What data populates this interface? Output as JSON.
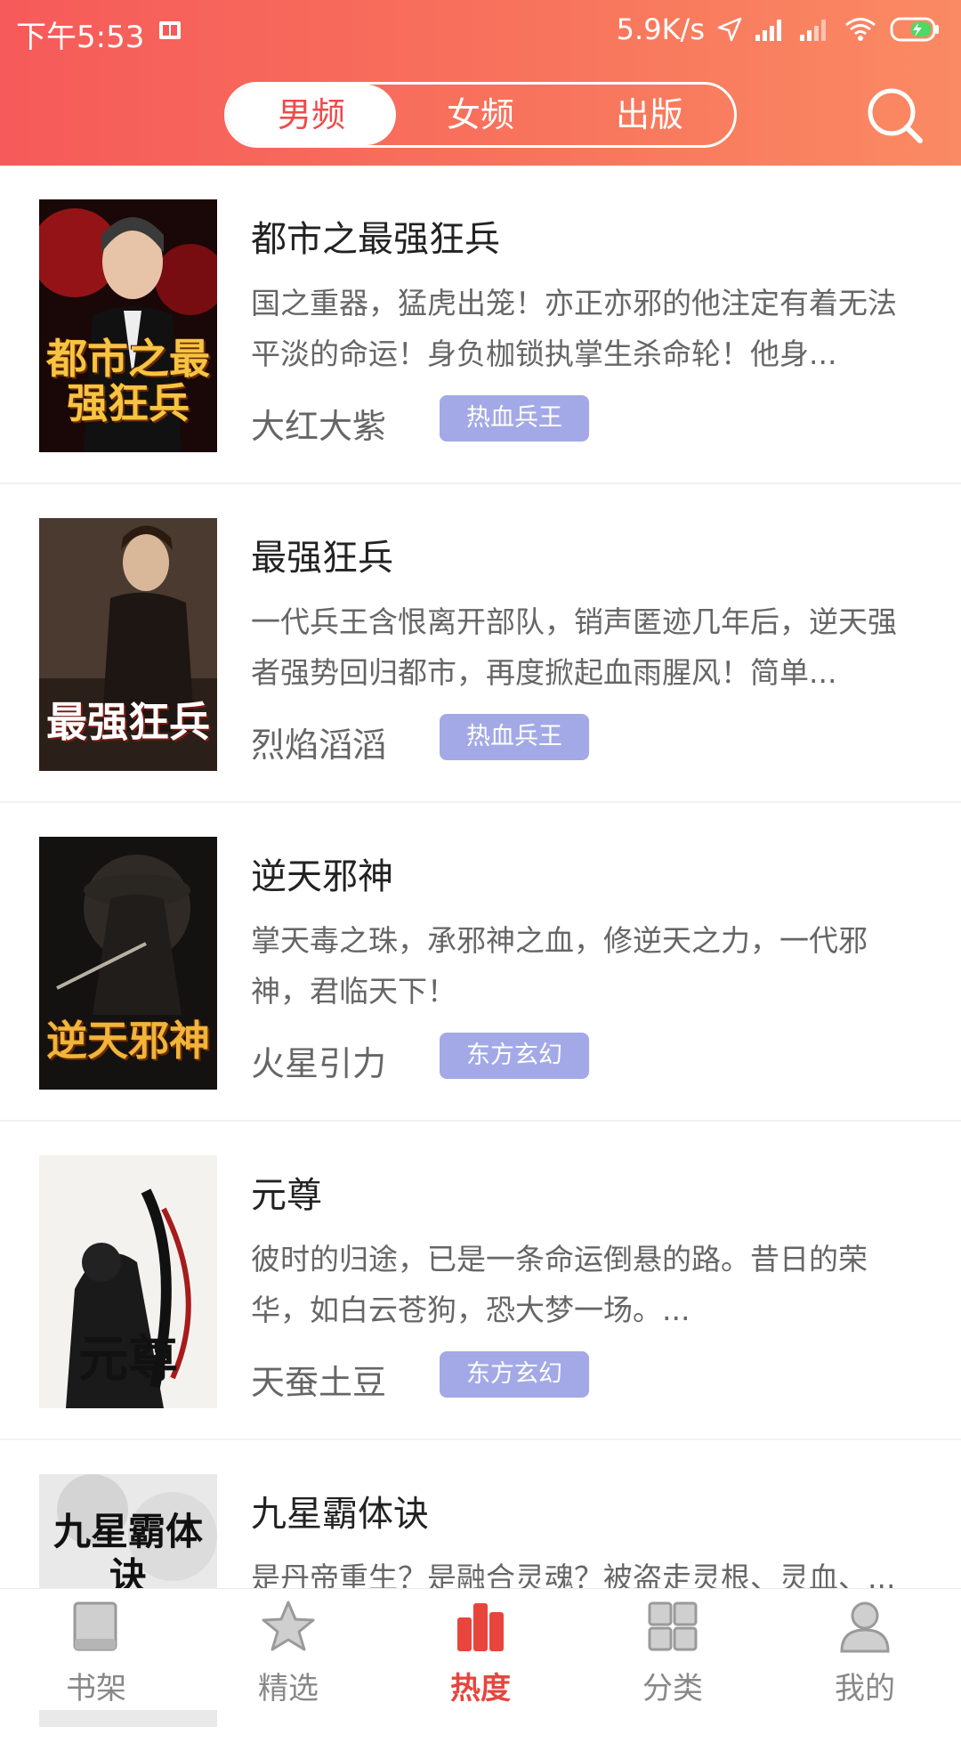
{
  "status_bar": {
    "time": "下午5:53",
    "network_speed": "5.9K/s"
  },
  "top_tabs": [
    {
      "label": "男频",
      "active": true
    },
    {
      "label": "女频",
      "active": false
    },
    {
      "label": "出版",
      "active": false
    }
  ],
  "icons": {
    "search": "search-icon",
    "bookshelf": "book-icon",
    "featured": "star-icon",
    "hot": "bar-chart-icon",
    "category": "grid-icon",
    "profile": "user-icon"
  },
  "colors": {
    "header_gradient_start": "#f65a5a",
    "header_gradient_end": "#fa8a63",
    "tag_bg": "#a3a9e6",
    "active_nav": "#e8453c"
  },
  "books": [
    {
      "title": "都市之最强狂兵",
      "description": "国之重器，猛虎出笼！亦正亦邪的他注定有着无法平淡的命运！身负枷锁执掌生杀命轮！他身...",
      "author": "大红大紫",
      "tag": "热血兵王",
      "cover_text": "都市之最强狂兵"
    },
    {
      "title": "最强狂兵",
      "description": "一代兵王含恨离开部队，销声匿迹几年后，逆天强者强势回归都市，再度掀起血雨腥风！简单...",
      "author": "烈焰滔滔",
      "tag": "热血兵王",
      "cover_text": "最强狂兵"
    },
    {
      "title": "逆天邪神",
      "description": "掌天毒之珠，承邪神之血，修逆天之力，一代邪神，君临天下！",
      "author": "火星引力",
      "tag": "东方玄幻",
      "cover_text": "逆天邪神"
    },
    {
      "title": "元尊",
      "description": "彼时的归途，已是一条命运倒悬的路。昔日的荣华，如白云苍狗，恐大梦一场。...",
      "author": "天蚕土豆",
      "tag": "东方玄幻",
      "cover_text": "元尊"
    },
    {
      "title": "九星霸体诀",
      "description": "是丹帝重生？是融合灵魂？被盗走灵根、灵血、...",
      "author": "",
      "tag": "",
      "cover_text": "九星霸体诀"
    }
  ],
  "bottom_nav": [
    {
      "label": "书架",
      "active": false
    },
    {
      "label": "精选",
      "active": false
    },
    {
      "label": "热度",
      "active": true
    },
    {
      "label": "分类",
      "active": false
    },
    {
      "label": "我的",
      "active": false
    }
  ]
}
